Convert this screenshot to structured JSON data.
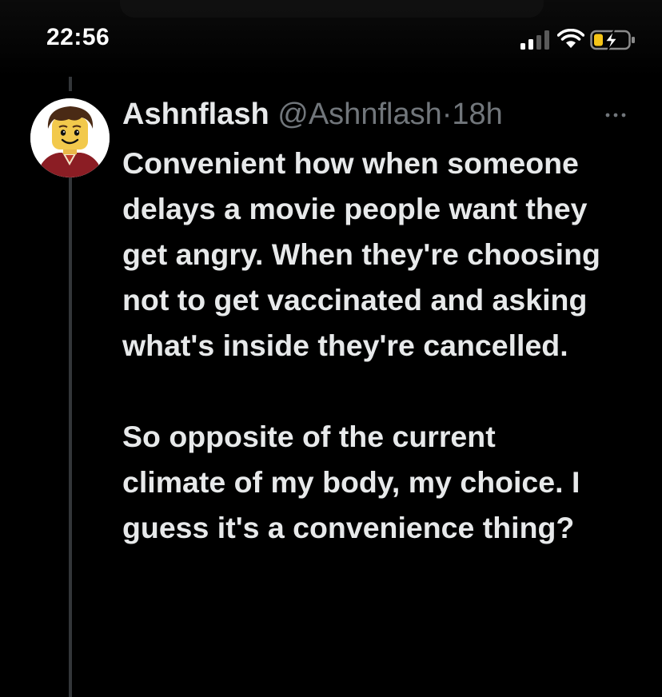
{
  "status_bar": {
    "time": "22:56",
    "icons": [
      "signal-icon",
      "wifi-icon",
      "battery-charging-icon"
    ],
    "battery_color": "#f5c518"
  },
  "tweet": {
    "display_name": "Ashnflash",
    "handle": "@Ashnflash",
    "separator": "·",
    "time": "18h",
    "more_icon": "more-horizontal-icon",
    "avatar_icon": "lego-figure-avatar",
    "body_paragraph_1": "Convenient how when someone delays a movie people want they get angry. When they're choosing not to get vaccinated and asking what's inside they're cancelled.",
    "body_paragraph_2": "So opposite of the current climate of my body, my choice. I guess it's a convenience thing?"
  },
  "colors": {
    "background": "#000000",
    "text_primary": "#e7e9ea",
    "text_secondary": "#71767b",
    "thread_line": "#333639"
  }
}
